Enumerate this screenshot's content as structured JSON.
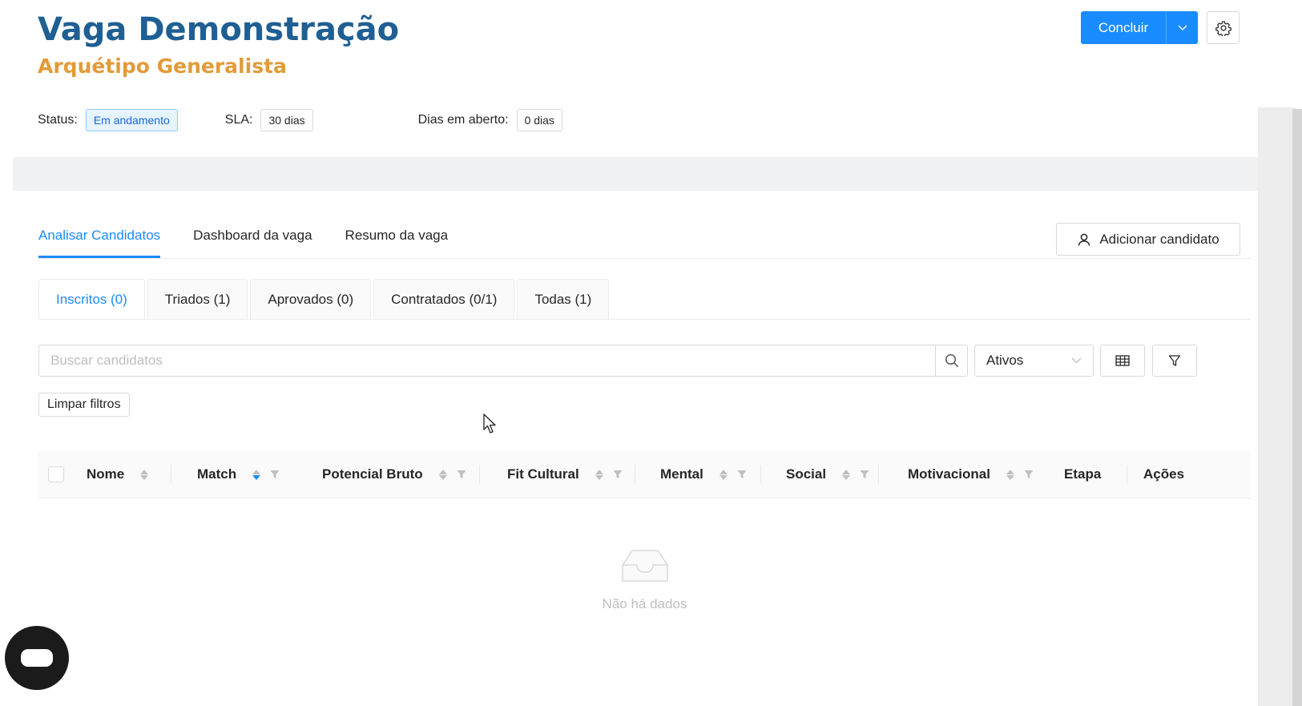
{
  "header": {
    "title": "Vaga Demonstração",
    "subtitle": "Arquétipo Generalista",
    "primary_action": "Concluir",
    "dropdown_icon": "chevron-down-icon",
    "settings_icon": "gear-icon"
  },
  "meta": {
    "status_label": "Status",
    "status_value": "Em andamento",
    "sla_label": "SLA",
    "sla_value": "30 dias",
    "open_days_label": "Dias em aberto",
    "open_days_value": "0 dias",
    "colon": ":"
  },
  "main_tabs": [
    {
      "label": "Analisar Candidatos",
      "active": true
    },
    {
      "label": "Dashboard da vaga",
      "active": false
    },
    {
      "label": "Resumo da vaga",
      "active": false
    }
  ],
  "add_candidate": {
    "label": "Adicionar candidato",
    "icon": "user-icon"
  },
  "stage_tabs": [
    {
      "label": "Inscritos (0)",
      "active": true
    },
    {
      "label": "Triados (1)",
      "active": false
    },
    {
      "label": "Aprovados (0)",
      "active": false
    },
    {
      "label": "Contratados (0/1)",
      "active": false
    },
    {
      "label": "Todas (1)",
      "active": false
    }
  ],
  "search": {
    "placeholder": "Buscar candidatos",
    "value": "",
    "icon": "search-icon"
  },
  "status_select": {
    "value": "Ativos"
  },
  "toolbar": {
    "columns_icon": "table-columns-icon",
    "filter_icon": "filter-icon",
    "clear_filters": "Limpar filtros"
  },
  "table": {
    "columns": [
      "Nome",
      "Match",
      "Potencial Bruto",
      "Fit Cultural",
      "Mental",
      "Social",
      "Motivacional",
      "Etapa",
      "Ações"
    ],
    "rows": [],
    "empty_text": "Não há dados"
  },
  "colors": {
    "primary": "#1a8cff",
    "title": "#1f5f93",
    "subtitle": "#e29b38"
  }
}
